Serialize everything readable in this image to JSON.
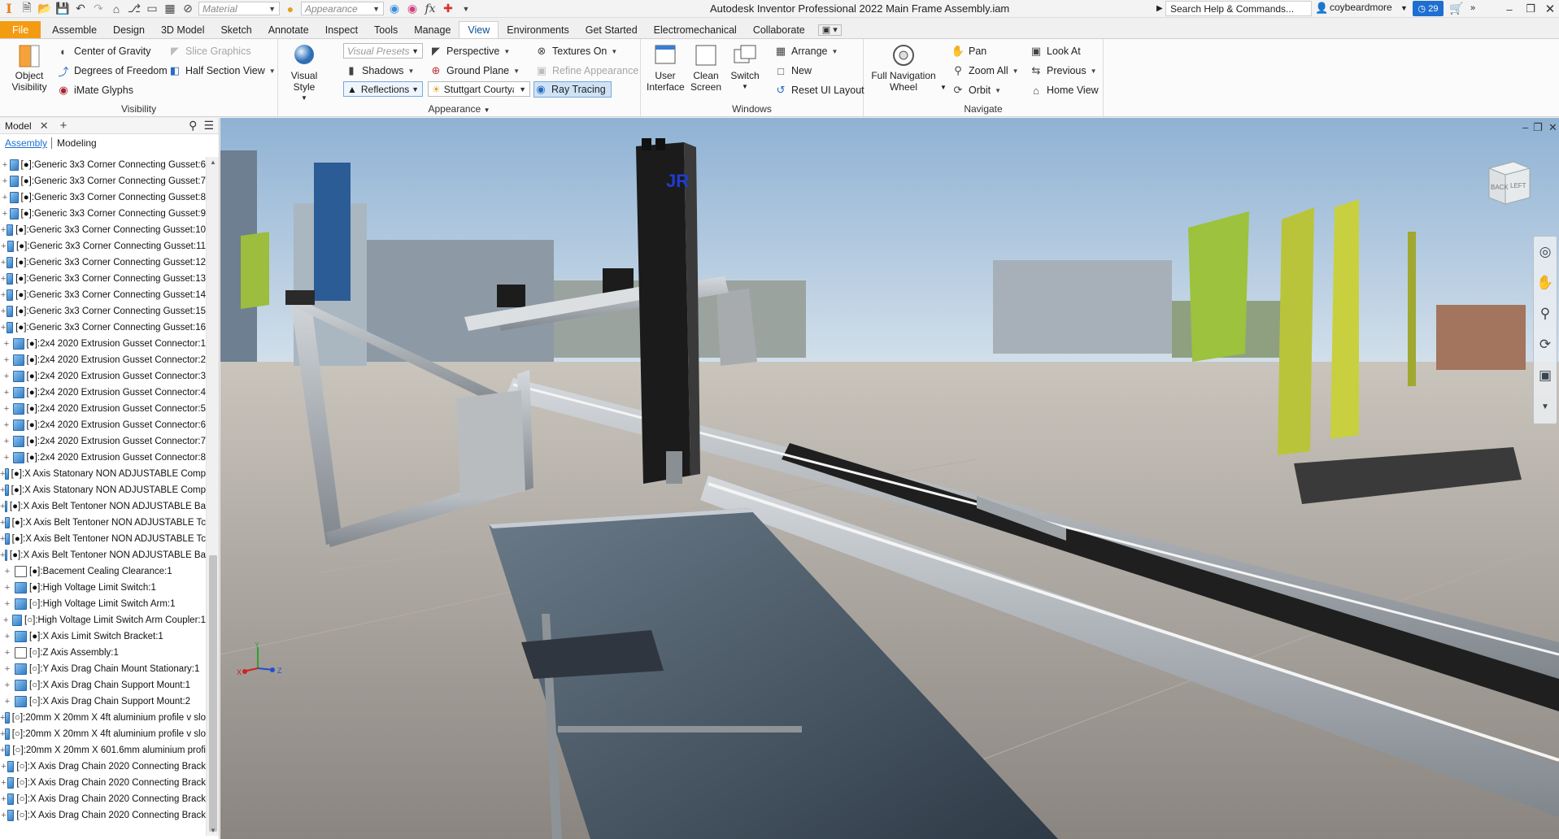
{
  "window": {
    "title": "Autodesk Inventor Professional 2022   Main Frame Assembly.iam",
    "search_placeholder": "Search Help & Commands...",
    "user": "coybeardmore",
    "notifications": "29",
    "quick_access": {
      "material_placeholder": "Material",
      "appearance_placeholder": "Appearance"
    }
  },
  "tabs": [
    "File",
    "Assemble",
    "Design",
    "3D Model",
    "Sketch",
    "Annotate",
    "Inspect",
    "Tools",
    "Manage",
    "View",
    "Environments",
    "Get Started",
    "Electromechanical",
    "Collaborate"
  ],
  "active_tab": "View",
  "ribbon": {
    "visibility": {
      "label": "Visibility",
      "object_visibility": "Object Visibility",
      "center_of_gravity": "Center of Gravity",
      "degrees_of_freedom": "Degrees of Freedom",
      "imate_glyphs": "iMate Glyphs",
      "slice_graphics": "Slice Graphics",
      "half_section_view": "Half Section View"
    },
    "appearance": {
      "label": "Appearance",
      "visual_style": "Visual Style",
      "visual_presets": "Visual Presets",
      "shadows": "Shadows",
      "reflections": "Reflections",
      "perspective": "Perspective",
      "ground_plane": "Ground Plane",
      "lighting": "Stuttgart Courtya",
      "textures_on": "Textures On",
      "refine_appearance": "Refine Appearance",
      "ray_tracing": "Ray Tracing"
    },
    "windows": {
      "label": "Windows",
      "user_interface": "User Interface",
      "clean_screen": "Clean Screen",
      "switch": "Switch",
      "arrange": "Arrange",
      "new": "New",
      "reset_ui_layout": "Reset UI Layout"
    },
    "navigate": {
      "label": "Navigate",
      "full_navigation_wheel": "Full Navigation Wheel",
      "pan": "Pan",
      "zoom_all": "Zoom All",
      "orbit": "Orbit",
      "look_at": "Look At",
      "previous": "Previous",
      "home_view": "Home View"
    }
  },
  "browser": {
    "tab": "Model",
    "sub_tabs": [
      "Assembly",
      "Modeling"
    ],
    "items": [
      "[●]:Generic 3x3 Corner Connecting Gusset:6",
      "[●]:Generic 3x3 Corner Connecting Gusset:7",
      "[●]:Generic 3x3 Corner Connecting Gusset:8",
      "[●]:Generic 3x3 Corner Connecting Gusset:9",
      "[●]:Generic 3x3 Corner Connecting Gusset:10",
      "[●]:Generic 3x3 Corner Connecting Gusset:11",
      "[●]:Generic 3x3 Corner Connecting Gusset:12",
      "[●]:Generic 3x3 Corner Connecting Gusset:13",
      "[●]:Generic 3x3 Corner Connecting Gusset:14",
      "[●]:Generic 3x3 Corner Connecting Gusset:15",
      "[●]:Generic 3x3 Corner Connecting Gusset:16",
      "[●]:2x4 2020 Extrusion Gusset Connector:1",
      "[●]:2x4 2020 Extrusion Gusset Connector:2",
      "[●]:2x4 2020 Extrusion Gusset Connector:3",
      "[●]:2x4 2020 Extrusion Gusset Connector:4",
      "[●]:2x4 2020 Extrusion Gusset Connector:5",
      "[●]:2x4 2020 Extrusion Gusset Connector:6",
      "[●]:2x4 2020 Extrusion Gusset Connector:7",
      "[●]:2x4 2020 Extrusion Gusset Connector:8",
      "[●]:X Axis Statonary NON ADJUSTABLE Comp",
      "[●]:X Axis Statonary NON ADJUSTABLE Comp",
      "[●]:X Axis Belt Tentoner NON ADJUSTABLE Ba",
      "[●]:X Axis Belt Tentoner NON ADJUSTABLE Tc",
      "[●]:X Axis Belt Tentoner NON ADJUSTABLE Tc",
      "[●]:X Axis Belt Tentoner NON ADJUSTABLE Ba",
      "[●]:Bacement Cealing Clearance:1",
      "[●]:High Voltage Limit Switch:1",
      "[○]:High Voltage Limit Switch Arm:1",
      "[○]:High Voltage Limit Switch Arm Coupler:1",
      "[●]:X Axis Limit Switch Bracket:1",
      "[○]:Z Axis Assembly:1",
      "[○]:Y Axis Drag Chain Mount Stationary:1",
      "[○]:X Axis Drag Chain Support Mount:1",
      "[○]:X Axis Drag Chain Support Mount:2",
      "[○]:20mm X 20mm X 4ft aluminium profile v slo",
      "[○]:20mm X 20mm X 4ft aluminium profile v slo",
      "[○]:20mm X 20mm X 601.6mm aluminium profi",
      "[○]:X Axis Drag Chain 2020 Connecting Brack",
      "[○]:X Axis Drag Chain 2020 Connecting Brack",
      "[○]:X Axis Drag Chain 2020 Connecting Brack",
      "[○]:X Axis Drag Chain 2020 Connecting Brack"
    ]
  },
  "viewport": {
    "model_label": "JR",
    "viewcube_faces": [
      "BACK",
      "LEFT"
    ],
    "axis_labels": [
      "X",
      "Y",
      "Z"
    ]
  }
}
